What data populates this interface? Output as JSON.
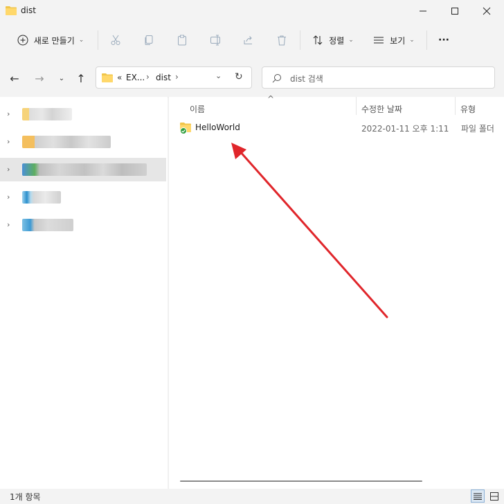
{
  "window": {
    "title": "dist"
  },
  "toolbar": {
    "new_label": "새로 만들기",
    "sort_label": "정렬",
    "view_label": "보기",
    "more_label": "···"
  },
  "nav": {
    "breadcrumb": {
      "overflow": "«",
      "segment1": "EX...",
      "segment2": "dist"
    },
    "search_placeholder": "dist 검색"
  },
  "columns": {
    "name": "이름",
    "date": "수정한 날짜",
    "type": "유형"
  },
  "files": [
    {
      "name": "HelloWorld",
      "date": "2022-01-11 오후 1:11",
      "type": "파일 폴더"
    }
  ],
  "status": {
    "count": "1개 항목"
  },
  "colors": {
    "accent": "#0067c0",
    "folder": "#f0c54a",
    "arrow": "#e0262b",
    "sync_check": "#2e9e3e"
  }
}
